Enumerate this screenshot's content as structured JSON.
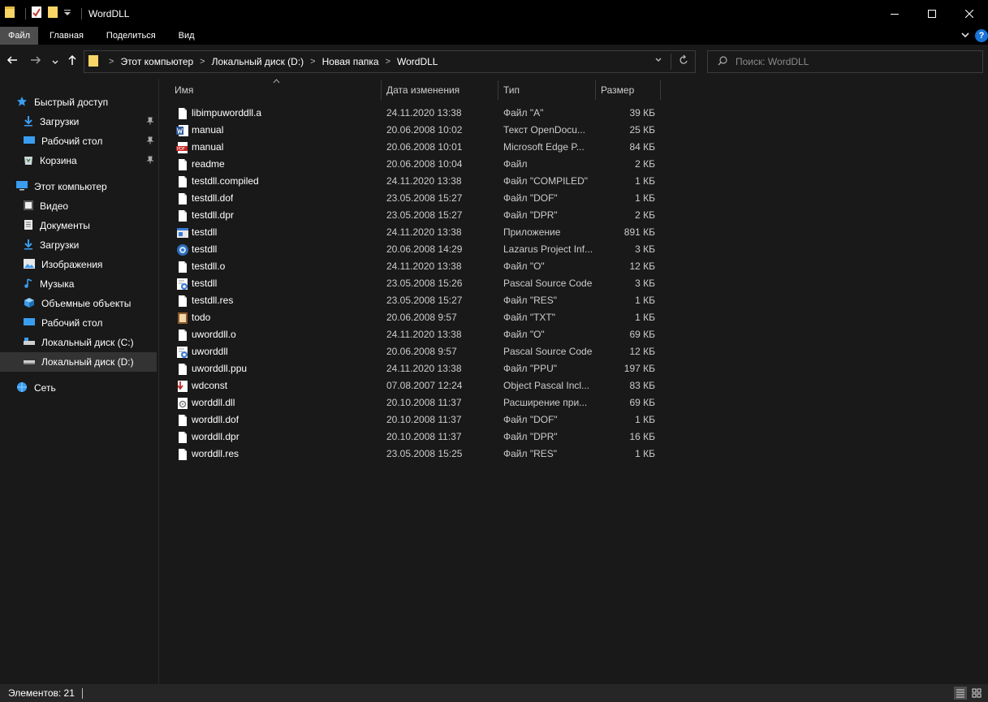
{
  "window": {
    "title": "WordDLL",
    "min_glyph": "—",
    "max_glyph": "☐",
    "close_glyph": "✕"
  },
  "ribbon": {
    "tabs": [
      {
        "label": "Файл",
        "active": true
      },
      {
        "label": "Главная",
        "active": false
      },
      {
        "label": "Поделиться",
        "active": false
      },
      {
        "label": "Вид",
        "active": false
      }
    ],
    "help_label": "?"
  },
  "address": {
    "crumbs": [
      "Этот компьютер",
      "Локальный диск (D:)",
      "Новая папка",
      "WordDLL"
    ]
  },
  "search": {
    "placeholder": "Поиск: WordDLL"
  },
  "sidebar": {
    "items": [
      {
        "label": "Быстрый доступ",
        "icon": "star-icon",
        "level": 0,
        "pinned": false,
        "selected": false
      },
      {
        "label": "Загрузки",
        "icon": "download-icon",
        "level": 1,
        "pinned": true,
        "selected": false
      },
      {
        "label": "Рабочий стол",
        "icon": "desktop-icon",
        "level": 1,
        "pinned": true,
        "selected": false
      },
      {
        "label": "Корзина",
        "icon": "recycle-bin-icon",
        "level": 1,
        "pinned": true,
        "selected": false
      },
      {
        "label": "Этот компьютер",
        "icon": "computer-icon",
        "level": 0,
        "pinned": false,
        "selected": false
      },
      {
        "label": "Видео",
        "icon": "video-icon",
        "level": 1,
        "pinned": false,
        "selected": false
      },
      {
        "label": "Документы",
        "icon": "documents-icon",
        "level": 1,
        "pinned": false,
        "selected": false
      },
      {
        "label": "Загрузки",
        "icon": "download-icon",
        "level": 1,
        "pinned": false,
        "selected": false
      },
      {
        "label": "Изображения",
        "icon": "pictures-icon",
        "level": 1,
        "pinned": false,
        "selected": false
      },
      {
        "label": "Музыка",
        "icon": "music-icon",
        "level": 1,
        "pinned": false,
        "selected": false
      },
      {
        "label": "Объемные объекты",
        "icon": "3d-objects-icon",
        "level": 1,
        "pinned": false,
        "selected": false
      },
      {
        "label": "Рабочий стол",
        "icon": "desktop-icon",
        "level": 1,
        "pinned": false,
        "selected": false
      },
      {
        "label": "Локальный диск (C:)",
        "icon": "drive-icon",
        "level": 1,
        "pinned": false,
        "selected": false
      },
      {
        "label": "Локальный диск (D:)",
        "icon": "drive-icon",
        "level": 1,
        "pinned": false,
        "selected": true
      },
      {
        "label": "Сеть",
        "icon": "network-icon",
        "level": 0,
        "pinned": false,
        "selected": false
      }
    ]
  },
  "columns": {
    "name": "Имя",
    "date": "Дата изменения",
    "type": "Тип",
    "size": "Размер"
  },
  "files": [
    {
      "name": "libimpuworddll.a",
      "date": "24.11.2020 13:38",
      "type": "Файл \"A\"",
      "size": "39 КБ",
      "icon": "file-icon"
    },
    {
      "name": "manual",
      "date": "20.06.2008 10:02",
      "type": "Текст OpenDocu...",
      "size": "25 КБ",
      "icon": "word-doc-icon"
    },
    {
      "name": "manual",
      "date": "20.06.2008 10:01",
      "type": "Microsoft Edge P...",
      "size": "84 КБ",
      "icon": "pdf-icon"
    },
    {
      "name": "readme",
      "date": "20.06.2008 10:04",
      "type": "Файл",
      "size": "2 КБ",
      "icon": "file-icon"
    },
    {
      "name": "testdll.compiled",
      "date": "24.11.2020 13:38",
      "type": "Файл \"COMPILED\"",
      "size": "1 КБ",
      "icon": "file-icon"
    },
    {
      "name": "testdll.dof",
      "date": "23.05.2008 15:27",
      "type": "Файл \"DOF\"",
      "size": "1 КБ",
      "icon": "file-icon"
    },
    {
      "name": "testdll.dpr",
      "date": "23.05.2008 15:27",
      "type": "Файл \"DPR\"",
      "size": "2 КБ",
      "icon": "file-icon"
    },
    {
      "name": "testdll",
      "date": "24.11.2020 13:38",
      "type": "Приложение",
      "size": "891 КБ",
      "icon": "application-icon"
    },
    {
      "name": "testdll",
      "date": "20.06.2008 14:29",
      "type": "Lazarus Project Inf...",
      "size": "3 КБ",
      "icon": "lazarus-icon"
    },
    {
      "name": "testdll.o",
      "date": "24.11.2020 13:38",
      "type": "Файл \"O\"",
      "size": "12 КБ",
      "icon": "file-icon"
    },
    {
      "name": "testdll",
      "date": "23.05.2008 15:26",
      "type": "Pascal Source Code",
      "size": "3 КБ",
      "icon": "pascal-source-icon"
    },
    {
      "name": "testdll.res",
      "date": "23.05.2008 15:27",
      "type": "Файл \"RES\"",
      "size": "1 КБ",
      "icon": "file-icon"
    },
    {
      "name": "todo",
      "date": "20.06.2008 9:57",
      "type": "Файл \"TXT\"",
      "size": "1 КБ",
      "icon": "text-file-icon"
    },
    {
      "name": "uworddll.o",
      "date": "24.11.2020 13:38",
      "type": "Файл \"O\"",
      "size": "69 КБ",
      "icon": "file-icon"
    },
    {
      "name": "uworddll",
      "date": "20.06.2008 9:57",
      "type": "Pascal Source Code",
      "size": "12 КБ",
      "icon": "pascal-source-icon"
    },
    {
      "name": "uworddll.ppu",
      "date": "24.11.2020 13:38",
      "type": "Файл \"PPU\"",
      "size": "197 КБ",
      "icon": "file-icon"
    },
    {
      "name": "wdconst",
      "date": "07.08.2007 12:24",
      "type": "Object Pascal Incl...",
      "size": "83 КБ",
      "icon": "pascal-include-icon"
    },
    {
      "name": "worddll.dll",
      "date": "20.10.2008 11:37",
      "type": "Расширение при...",
      "size": "69 КБ",
      "icon": "dll-icon"
    },
    {
      "name": "worddll.dof",
      "date": "20.10.2008 11:37",
      "type": "Файл \"DOF\"",
      "size": "1 КБ",
      "icon": "file-icon"
    },
    {
      "name": "worddll.dpr",
      "date": "20.10.2008 11:37",
      "type": "Файл \"DPR\"",
      "size": "16 КБ",
      "icon": "file-icon"
    },
    {
      "name": "worddll.res",
      "date": "23.05.2008 15:25",
      "type": "Файл \"RES\"",
      "size": "1 КБ",
      "icon": "file-icon"
    }
  ],
  "status": {
    "items_count": "Элементов: 21"
  },
  "colors": {
    "background": "#191919",
    "titlebar": "#000000",
    "selected": "#333333",
    "accent": "#1a73d6",
    "folder": "#f7d567"
  }
}
